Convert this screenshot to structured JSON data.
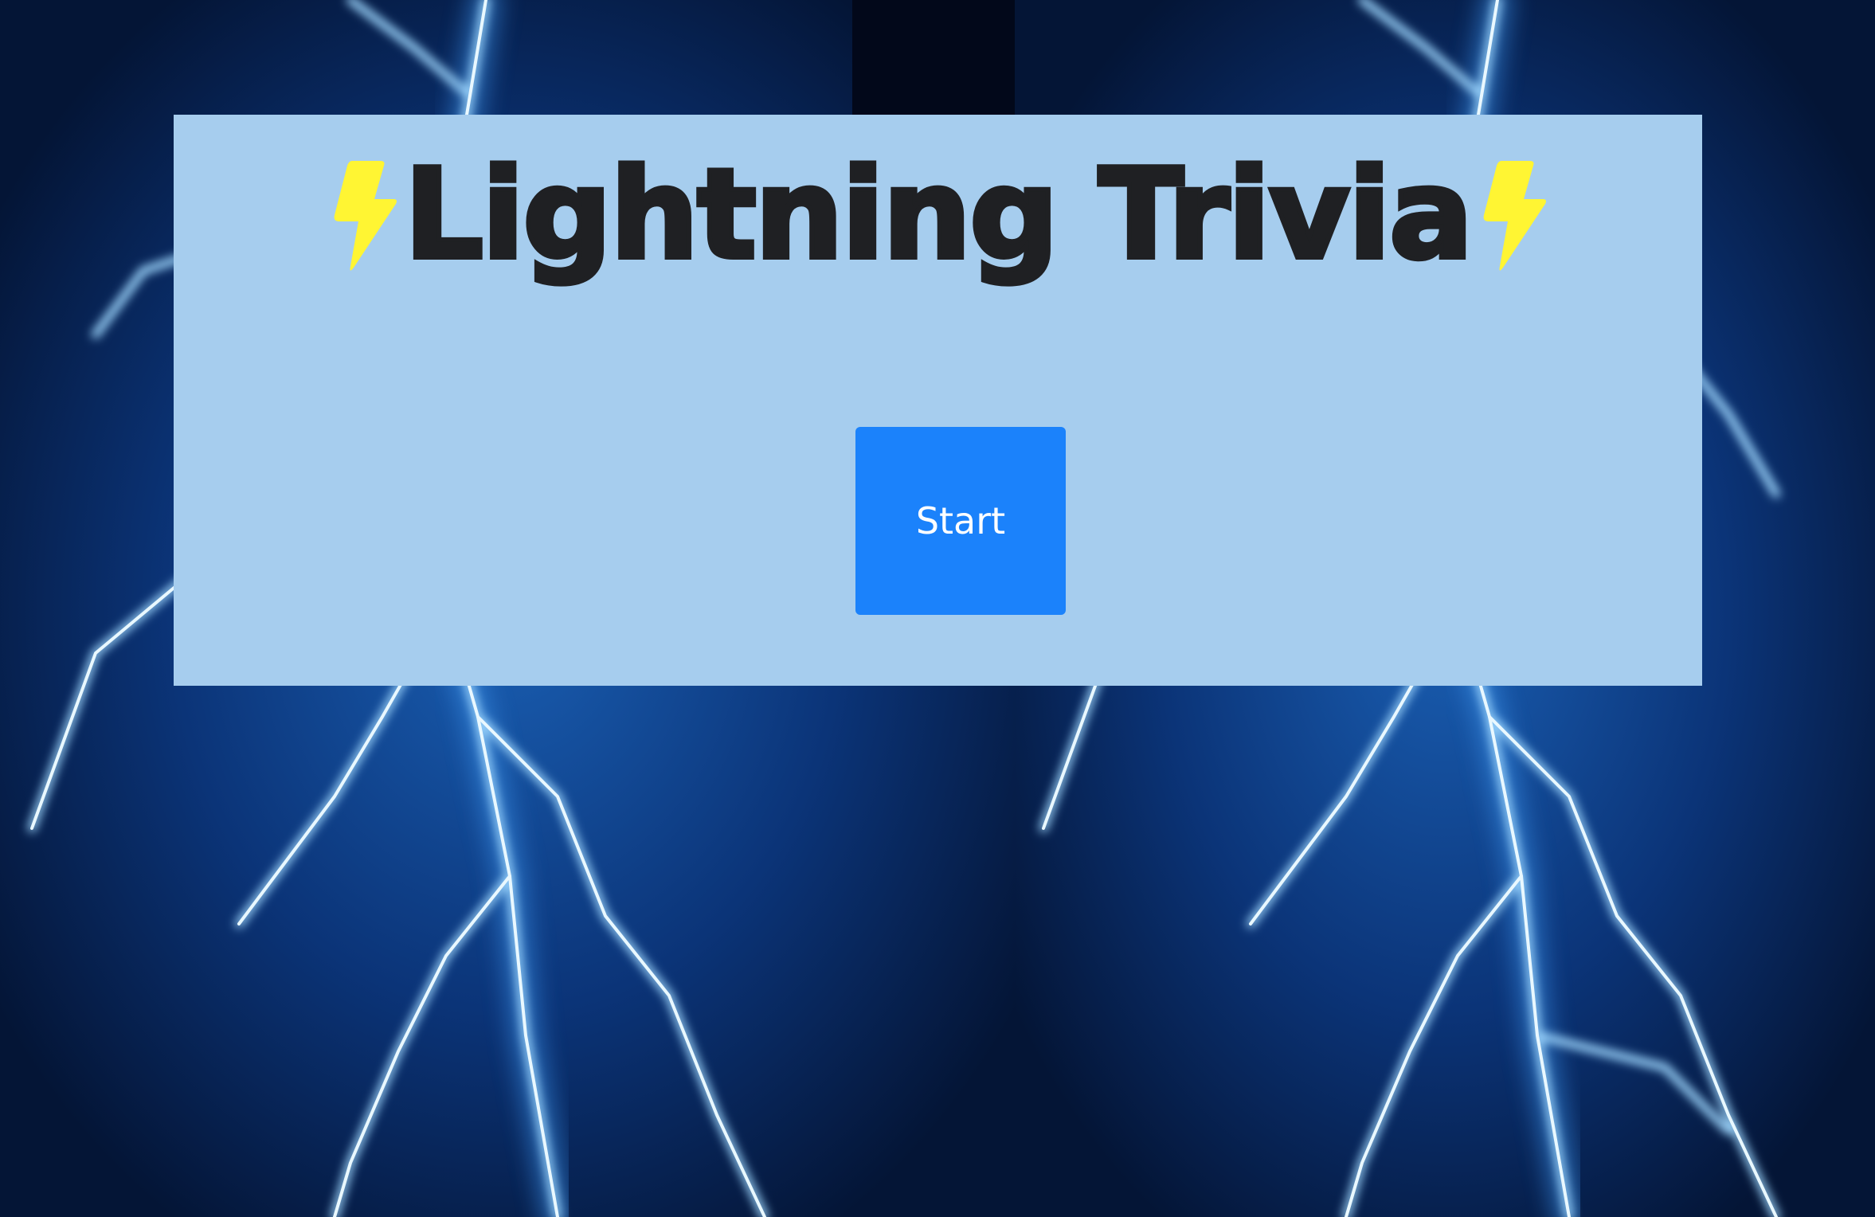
{
  "page": {
    "title": "Lightning Trivia",
    "title_icon_left": "high-voltage-icon",
    "title_icon_right": "high-voltage-icon"
  },
  "actions": {
    "start_label": "Start"
  },
  "colors": {
    "card_background": "#a6cdee",
    "button_background": "#1b82fb",
    "title_text": "#1f2023",
    "bolt_icon": "#fff533",
    "background_dark": "#061a44"
  }
}
